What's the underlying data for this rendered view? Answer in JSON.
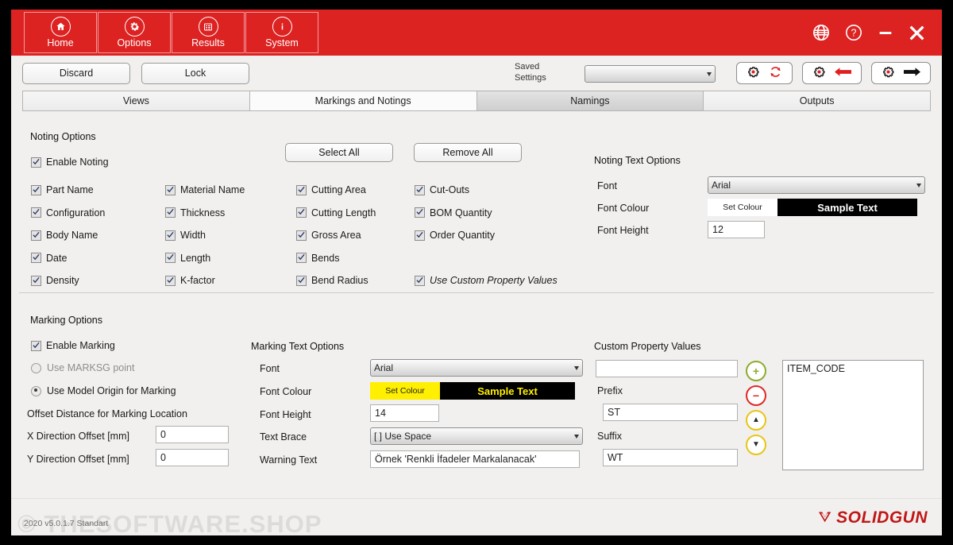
{
  "header": {
    "nav": [
      {
        "label": "Home",
        "icon": "home-icon"
      },
      {
        "label": "Options",
        "icon": "gear-icon"
      },
      {
        "label": "Results",
        "icon": "list-icon"
      },
      {
        "label": "System",
        "icon": "info-icon"
      }
    ],
    "window_controls": [
      {
        "name": "globe-icon"
      },
      {
        "name": "help-icon"
      },
      {
        "name": "minimize-icon"
      },
      {
        "name": "close-icon"
      }
    ]
  },
  "toolbar": {
    "discard_label": "Discard",
    "lock_label": "Lock",
    "saved_settings_label_line1": "Saved",
    "saved_settings_label_line2": "Settings",
    "saved_settings_value": "",
    "groups": [
      {
        "name": "settings-refresh",
        "icons": [
          "gear-icon",
          "refresh-icon"
        ]
      },
      {
        "name": "settings-load",
        "icons": [
          "gear-icon",
          "arrow-left-icon"
        ]
      },
      {
        "name": "settings-save",
        "icons": [
          "gear-icon",
          "arrow-right-icon"
        ]
      }
    ]
  },
  "tabs": [
    {
      "label": "Views",
      "state": "normal"
    },
    {
      "label": "Markings and Notings",
      "state": "active"
    },
    {
      "label": "Namings",
      "state": "hover"
    },
    {
      "label": "Outputs",
      "state": "normal"
    }
  ],
  "noting": {
    "section_title": "Noting Options",
    "enable": {
      "label": "Enable Noting",
      "checked": true
    },
    "select_all_label": "Select All",
    "remove_all_label": "Remove All",
    "col1": [
      {
        "label": "Part Name",
        "checked": true
      },
      {
        "label": "Configuration",
        "checked": true
      },
      {
        "label": "Body Name",
        "checked": true
      },
      {
        "label": "Date",
        "checked": true
      },
      {
        "label": "Density",
        "checked": true
      }
    ],
    "col2": [
      {
        "label": "Material Name",
        "checked": true
      },
      {
        "label": "Thickness",
        "checked": true
      },
      {
        "label": "Width",
        "checked": true
      },
      {
        "label": "Length",
        "checked": true
      },
      {
        "label": "K-factor",
        "checked": true
      }
    ],
    "col3": [
      {
        "label": "Cutting Area",
        "checked": true
      },
      {
        "label": "Cutting Length",
        "checked": true
      },
      {
        "label": "Gross Area",
        "checked": true
      },
      {
        "label": "Bends",
        "checked": true
      },
      {
        "label": "Bend Radius",
        "checked": true
      }
    ],
    "col4": [
      {
        "label": "Cut-Outs",
        "checked": true
      },
      {
        "label": "BOM Quantity",
        "checked": true
      },
      {
        "label": "Order Quantity",
        "checked": true
      },
      {
        "label": "",
        "checked": false
      },
      {
        "label": "Use Custom Property Values",
        "checked": true,
        "italic": true
      }
    ],
    "text_options": {
      "title": "Noting Text Options",
      "font_label": "Font",
      "font_value": "Arial",
      "colour_label": "Font Colour",
      "set_colour_label": "Set Colour",
      "sample_label": "Sample Text",
      "colour_hex": "#ffffff",
      "sample_bg_hex": "#000000",
      "height_label": "Font Height",
      "height_value": "12"
    }
  },
  "marking": {
    "section_title": "Marking Options",
    "enable": {
      "label": "Enable Marking",
      "checked": true
    },
    "radios": [
      {
        "label": "Use MARKSG point",
        "selected": false,
        "dim": true
      },
      {
        "label": "Use Model Origin for Marking",
        "selected": true,
        "dim": false
      }
    ],
    "offset_title": "Offset Distance for Marking Location",
    "x_offset_label": "X Direction Offset [mm]",
    "x_offset_value": "0",
    "y_offset_label": "Y Direction Offset [mm]",
    "y_offset_value": "0",
    "text_options": {
      "title": "Marking Text Options",
      "font_label": "Font",
      "font_value": "Arial",
      "colour_label": "Font Colour",
      "set_colour_label": "Set Colour",
      "sample_label": "Sample Text",
      "colour_hex": "#ffef00",
      "sample_bg_hex": "#000000",
      "height_label": "Font Height",
      "height_value": "14",
      "brace_label": "Text Brace",
      "brace_value": "[  ] Use Space",
      "warning_label": "Warning Text",
      "warning_value": "Örnek 'Renkli İfadeler Markalanacak'"
    }
  },
  "custom_property": {
    "title": "Custom Property Values",
    "new_value": "",
    "prefix_label": "Prefix",
    "prefix_value": "ST",
    "suffix_label": "Suffix",
    "suffix_value": "WT",
    "buttons": [
      {
        "name": "add-property-button",
        "glyph": "+",
        "colour": "#8cab2e"
      },
      {
        "name": "remove-property-button",
        "glyph": "−",
        "colour": "#e02828"
      },
      {
        "name": "move-up-button",
        "glyph": "▲",
        "colour": "#e8c515"
      },
      {
        "name": "move-down-button",
        "glyph": "▼",
        "colour": "#e8c515"
      }
    ],
    "list_items": [
      "ITEM_CODE"
    ]
  },
  "footer": {
    "version": "2020 v5.0.1.7 Standart",
    "watermark": "© THESOFTWARE.SHOP",
    "logo_text": "SOLIDGUN",
    "logo_colour": "#c01616"
  }
}
